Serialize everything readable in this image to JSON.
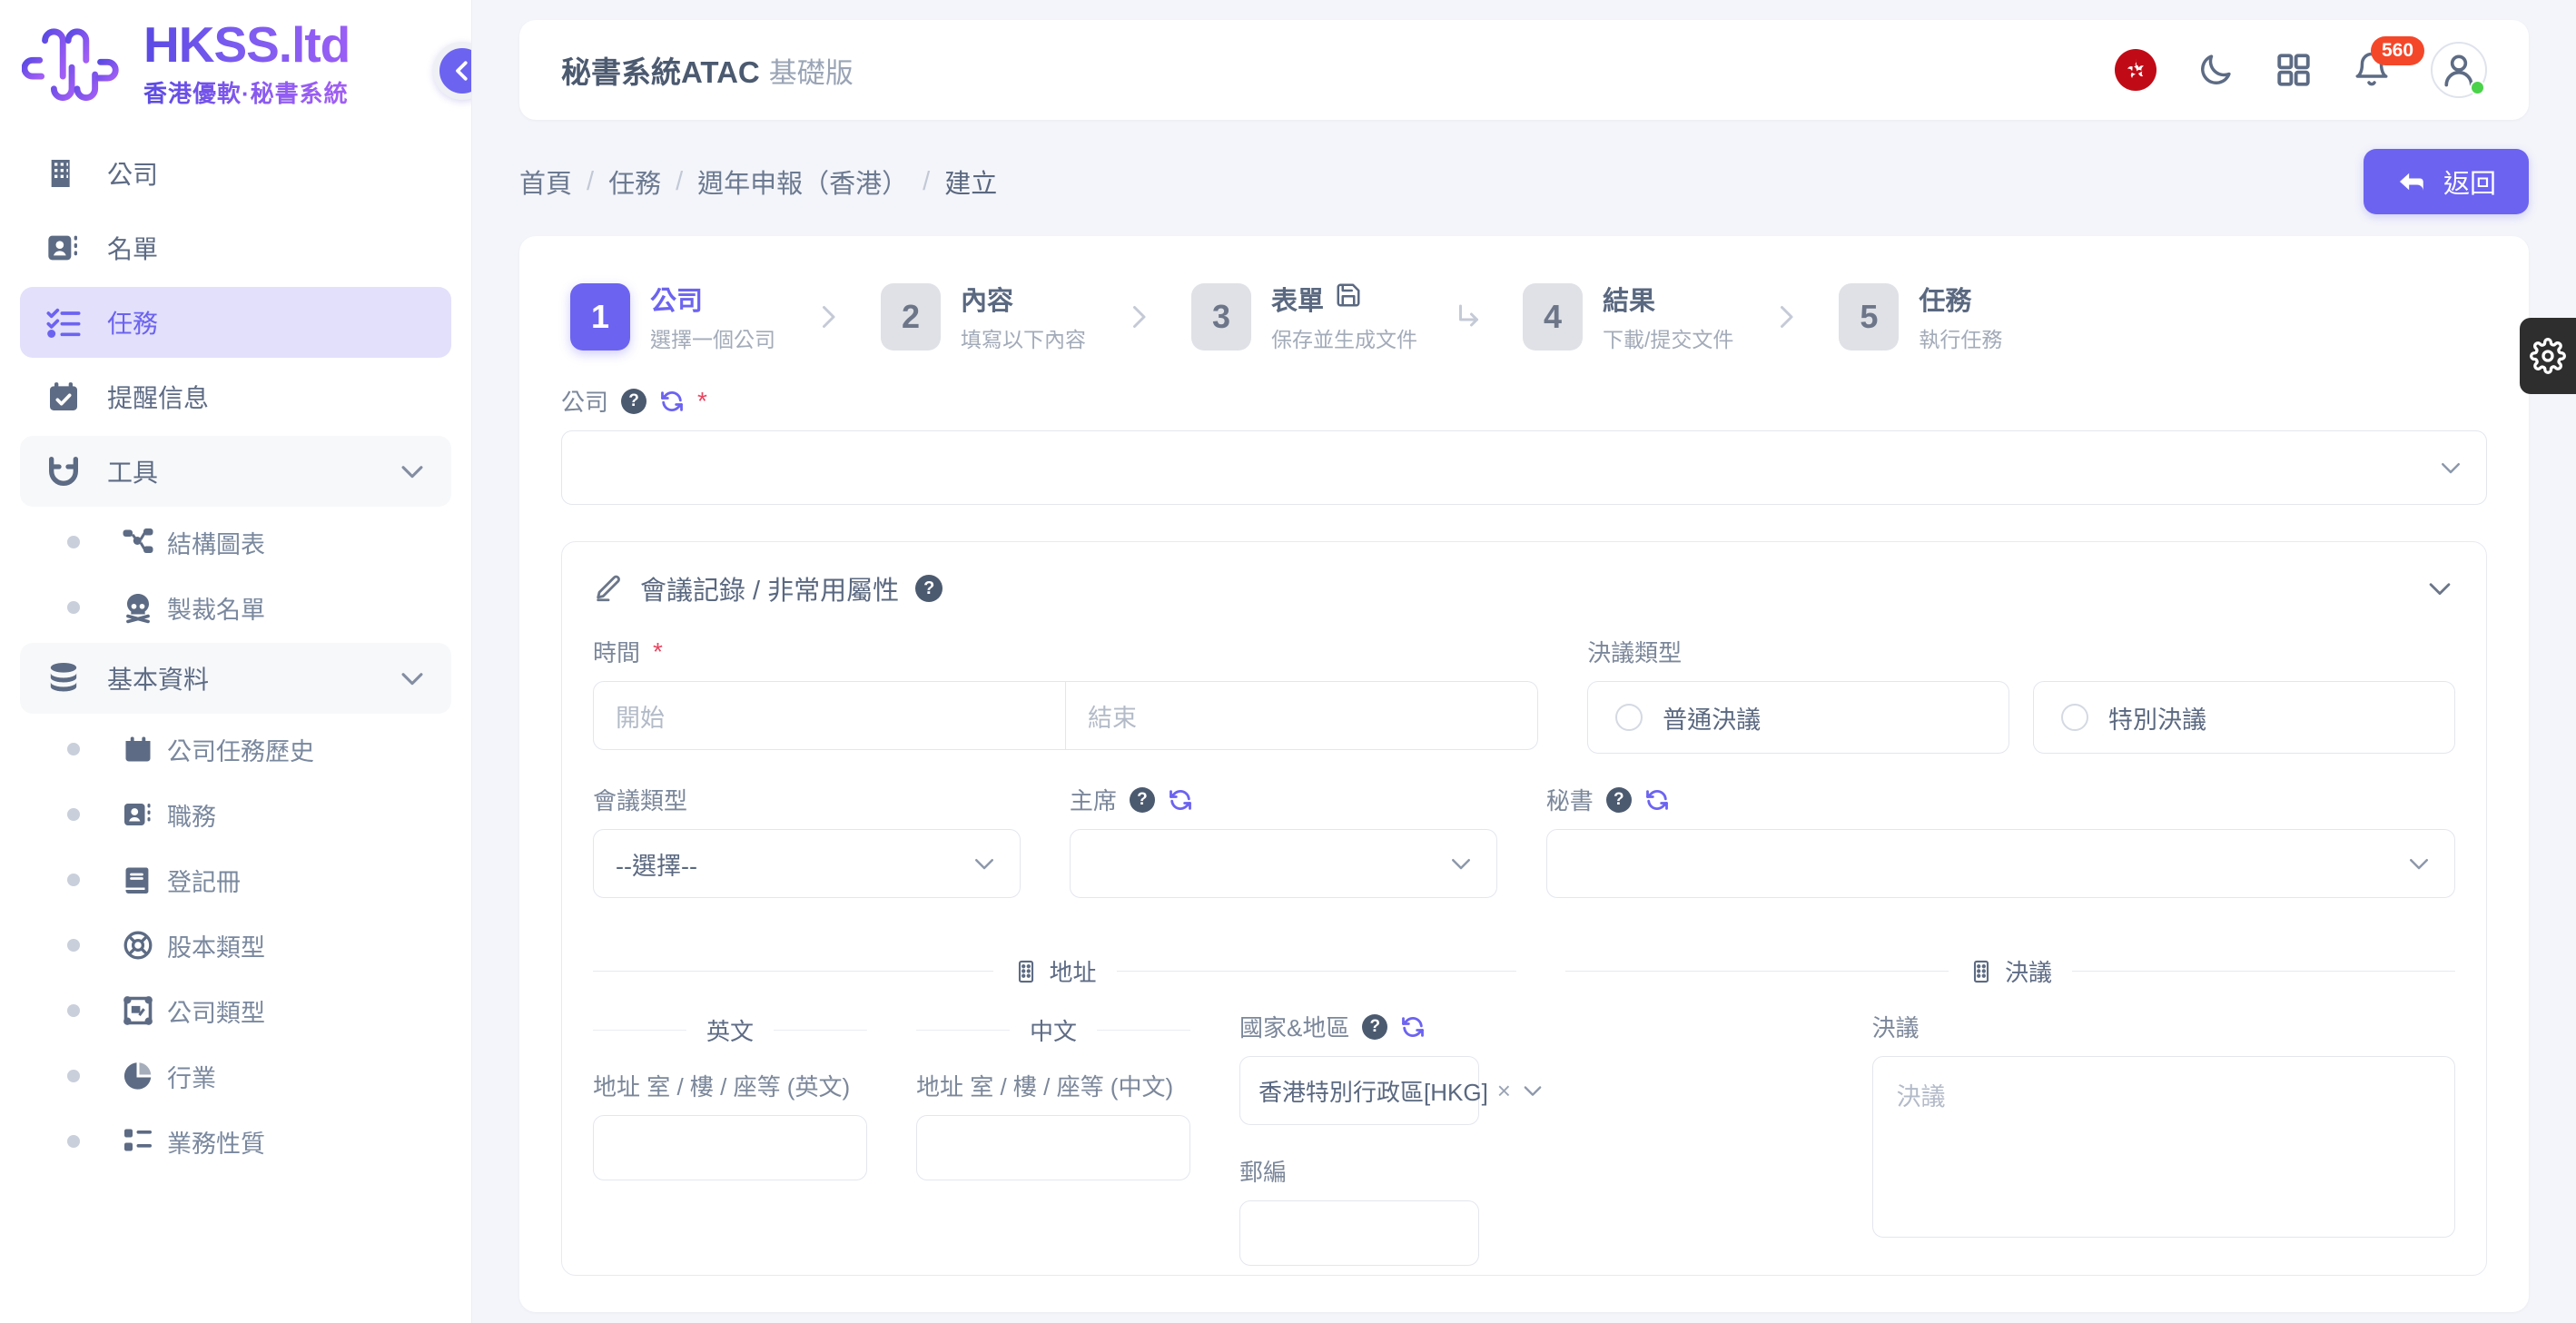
{
  "sidebar": {
    "logo": {
      "title": "HKSS.ltd",
      "subtitle": "香港優軟·秘書系統"
    },
    "collapse_label": "收起側邊欄",
    "items": [
      {
        "label": "公司",
        "icon": "building-icon",
        "type": "item"
      },
      {
        "label": "名單",
        "icon": "contact-card-icon",
        "type": "item"
      },
      {
        "label": "任務",
        "icon": "checklist-icon",
        "type": "item",
        "active": true
      },
      {
        "label": "提醒信息",
        "icon": "calendar-check-icon",
        "type": "item"
      },
      {
        "label": "工具",
        "icon": "magnet-icon",
        "type": "group"
      },
      {
        "label": "結構圖表",
        "icon": "sitemap-icon",
        "type": "sub"
      },
      {
        "label": "製裁名單",
        "icon": "skull-icon",
        "type": "sub"
      },
      {
        "label": "基本資料",
        "icon": "database-icon",
        "type": "group"
      },
      {
        "label": "公司任務歷史",
        "icon": "calendar-icon",
        "type": "sub"
      },
      {
        "label": "職務",
        "icon": "contact-card-icon",
        "type": "sub"
      },
      {
        "label": "登記冊",
        "icon": "book-icon",
        "type": "sub"
      },
      {
        "label": "股本類型",
        "icon": "lifebuoy-icon",
        "type": "sub"
      },
      {
        "label": "公司類型",
        "icon": "frame-photo-icon",
        "type": "sub"
      },
      {
        "label": "行業",
        "icon": "pie-chart-icon",
        "type": "sub"
      },
      {
        "label": "業務性質",
        "icon": "list-icon",
        "type": "sub"
      }
    ]
  },
  "topbar": {
    "app_title": "秘書系統ATAC",
    "edition": "基礎版",
    "icons": [
      {
        "name": "hk-flag-icon"
      },
      {
        "name": "moon-icon"
      },
      {
        "name": "grid-apps-icon"
      },
      {
        "name": "bell-icon",
        "badge": "560"
      },
      {
        "name": "user-avatar-icon",
        "status": "online"
      }
    ]
  },
  "breadcrumb": {
    "items": [
      "首頁",
      "任務",
      "週年申報（香港）",
      "建立"
    ],
    "separator": "/"
  },
  "back_button": {
    "label": "返回",
    "icon": "arrow-back-icon"
  },
  "stepper": [
    {
      "num": "1",
      "title": "公司",
      "sub": "選擇一個公司",
      "active": true,
      "arrow": "chevron-right"
    },
    {
      "num": "2",
      "title": "內容",
      "sub": "填寫以下內容",
      "active": false,
      "arrow": "chevron-right"
    },
    {
      "num": "3",
      "title": "表單",
      "sub": "保存並生成文件",
      "active": false,
      "icon": "save-icon",
      "arrow": "corner-down-right"
    },
    {
      "num": "4",
      "title": "結果",
      "sub": "下載/提交文件",
      "active": false,
      "arrow": "chevron-right"
    },
    {
      "num": "5",
      "title": "任務",
      "sub": "執行任務",
      "active": false
    }
  ],
  "form": {
    "company": {
      "label": "公司",
      "value": "",
      "placeholder": "",
      "required_mark": "*",
      "help_icon": "question-icon",
      "refresh_icon": "refresh-icon"
    },
    "panel": {
      "title": "會議記錄 / 非常用屬性",
      "edit_icon": "pencil-icon",
      "help_icon": "question-icon",
      "collapse_icon": "chevron-down-icon"
    },
    "time": {
      "label": "時間",
      "required_mark": "*",
      "start_placeholder": "開始",
      "end_placeholder": "結束",
      "start_value": "",
      "end_value": ""
    },
    "resolution_type": {
      "label": "決議類型",
      "options": [
        {
          "label": "普通決議",
          "selected": false
        },
        {
          "label": "特別決議",
          "selected": false
        }
      ]
    },
    "meeting_type": {
      "label": "會議類型",
      "value": "--選擇--"
    },
    "chairman": {
      "label": "主席",
      "value": "",
      "help_icon": "question-icon",
      "refresh_icon": "refresh-icon"
    },
    "secretary": {
      "label": "秘書",
      "value": "",
      "help_icon": "question-icon",
      "refresh_icon": "refresh-icon"
    },
    "address_divider": {
      "label": "地址",
      "icon": "building-small-icon"
    },
    "resolution_divider": {
      "label": "決議",
      "icon": "building-small-icon"
    },
    "lang_en_divider": "英文",
    "lang_zh_divider": "中文",
    "address_en": {
      "label": "地址 室 / 樓 / 座等 (英文)",
      "value": ""
    },
    "address_zh": {
      "label": "地址 室 / 樓 / 座等 (中文)",
      "value": ""
    },
    "country_region": {
      "label": "國家&地區",
      "help_icon": "question-icon",
      "refresh_icon": "refresh-icon",
      "tag": "香港特別行政區[HKG]",
      "remove_glyph": "×"
    },
    "postcode": {
      "label": "郵編",
      "value": ""
    },
    "resolution": {
      "label": "決議",
      "placeholder": "決議",
      "value": ""
    }
  },
  "settings_fab": {
    "icon": "gear-icon",
    "label": "設定"
  },
  "colors": {
    "accent": "#6c63f1",
    "accent_soft": "#e2e0fb",
    "text": "#5a6880",
    "muted": "#a3abb9",
    "danger": "#e8455f",
    "badge": "#f4472a",
    "flag": "#c00b16",
    "online": "#4ad34a"
  }
}
